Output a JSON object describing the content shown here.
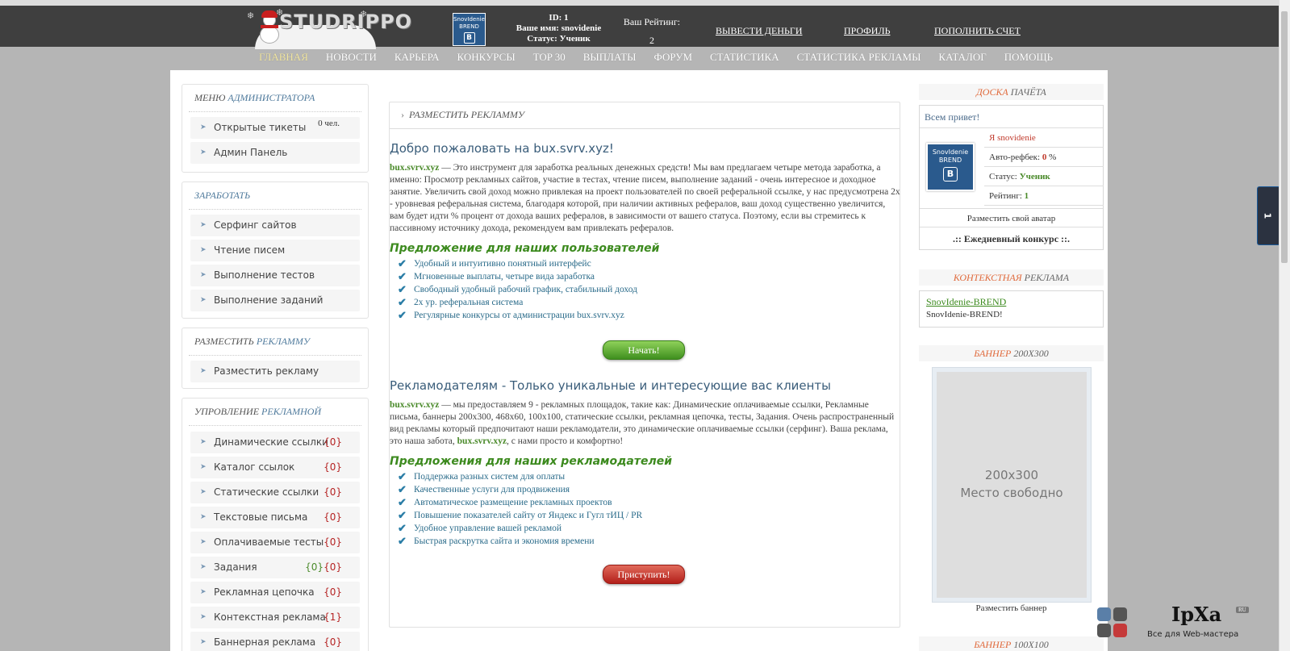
{
  "header": {
    "logo_text": "STUDRIPPO",
    "avatar_text": "SnovIdenie",
    "avatar_sub": "BREND",
    "avatar_badge": "B",
    "user_id": "ID: 1",
    "user_name_label": "Ваше имя:",
    "user_name": "snovidenie",
    "status_label": "Статус:",
    "status": "Ученик",
    "rating_label": "Ваш Рейтинг:",
    "rating_value": "2",
    "links": {
      "withdraw": "ВЫВЕСТИ ДЕНЬГИ",
      "profile": "ПРОФИЛЬ",
      "topup": "ПОПОЛНИТЬ СЧЕТ"
    }
  },
  "nav": {
    "items": [
      "ГЛАВНАЯ",
      "НОВОСТИ",
      "КАРЬЕРА",
      "КОНКУРСЫ",
      "TOP 30",
      "ВЫПЛАТЫ",
      "ФОРУМ",
      "СТАТИСТИКА",
      "СТАТИСТИКА РЕКЛАМЫ",
      "КАТАЛОГ",
      "ПОМОЩЬ"
    ],
    "active": "ГЛАВНАЯ"
  },
  "sidebar": {
    "admin": {
      "title_a": "МЕНЮ ",
      "title_b": "АДМИНИСТРАТОРА",
      "items": [
        {
          "label": "Открытые тикеты",
          "count": "0 чел."
        },
        {
          "label": "Админ Панель"
        }
      ]
    },
    "earn": {
      "title_a": "ЗАРАБОТАТЬ",
      "title_b": "",
      "items": [
        {
          "label": "Серфинг сайтов"
        },
        {
          "label": "Чтение писем"
        },
        {
          "label": "Выполнение тестов"
        },
        {
          "label": "Выполнение заданий"
        }
      ]
    },
    "place_ad": {
      "title_a": "РАЗМЕСТИТЬ ",
      "title_b": "РЕКЛАММУ",
      "items": [
        {
          "label": "Разместить рекламу"
        }
      ]
    },
    "manage_ad": {
      "title_a": "УПРОВЛЕНИЕ ",
      "title_b": "РЕКЛАМНОЙ",
      "items": [
        {
          "label": "Динамические ссылки",
          "count": "{0}"
        },
        {
          "label": "Каталог ссылок",
          "count": "{0}"
        },
        {
          "label": "Статические ссылки",
          "count": "{0}"
        },
        {
          "label": "Текстовые письма",
          "count": "{0}"
        },
        {
          "label": "Оплачиваемые тесты",
          "count": "{0}"
        },
        {
          "label": "Задания",
          "count": "{0}",
          "count2": "{0}"
        },
        {
          "label": "Рекламная цепочка",
          "count": "{0}"
        },
        {
          "label": "Контекстная реклама",
          "count": "{1}"
        },
        {
          "label": "Баннерная реклама",
          "count": "{0}"
        }
      ]
    }
  },
  "content": {
    "title": "РАЗМЕСТИТЬ РЕКЛАММУ",
    "welcome": "Добро пожаловать на bux.svrv.xyz!",
    "site": "bux.svrv.xyz",
    "intro": " — Это инструмент для заработка реальных денежных средств! Мы вам предлагаем четыре метода заработка, а именно: Просмотр рекламных сайтов, участие в тестах, чтение писем, выполнение заданий - очень интересное и доходное занятие. Увеличить свой доход можно привлекая на проект пользователей по своей реферальной ссылке, у нас предусмотрена 2x - уровневая реферальная система, благодаря которой, при наличии активных рефералов, ваш доход существенно увеличится, вам будет идти % процент от дохода ваших рефералов, в зависимости от вашего статуса. Поэтому, если вы стремитесь к пассивному источнику дохода, рекомендуем вам привлекать рефералов.",
    "offer_users_title": "Предложение для наших пользователей",
    "offer_users": [
      "Удобный и интуитивно понятный интерфейс",
      "Мгновенные выплаты, четыре вида заработка",
      "Свободный удобный рабочий график, стабильный доход",
      "2х ур. реферальная система",
      "Регулярные конкурсы от администрации bux.svrv.xyz"
    ],
    "start_button": "Начать!",
    "advertisers_title": "Рекламодателям - Только уникальные и интересующие вас клиенты",
    "advertisers_text": " — мы предоставляем 9 - рекламных площадок, такие как: Динамические оплачиваемые ссылки, Рекламные письма, баннеры 200x300, 468x60, 100x100, статические ссылки, рекламная цепочка, тесты, Задания. Очень распространенный вид рекламы который предпочитают наши рекламодатели, это динамические оплачиваемые ссылки (серфинг). Ваша реклама, это наша забота, ",
    "advertisers_tail": ", с нами просто и комфортно!",
    "offer_adv_title": "Предложения для наших рекламодателей",
    "offer_adv": [
      "Поддержка разных систем для оплаты",
      "Качественные услуги для продвижения",
      "Автоматическое размещение рекламных проектов",
      "Повышение показателей сайту от Яндекс и Гугл тИЦ / PR",
      "Удобное управление вашей рекламой",
      "Быстрая раскрутка сайта и экономия времени"
    ],
    "proceed_button": "Приступить!"
  },
  "right": {
    "board_title_a": "ДОСКА ",
    "board_title_b": "ПАЧЁТА",
    "greeting": "Всем привет!",
    "me_prefix": "Я ",
    "me_name": "snovidenie",
    "autoref_label": "Авто-рефбек: ",
    "autoref_value": "0",
    "autoref_unit": " %",
    "status_label": "Статус: ",
    "status_value": "Ученик",
    "rating_label": "Рейтинг: ",
    "rating_value": "1",
    "avatar_link": "Разместить свой аватар",
    "daily_contest": ".:: Ежедневный конкурс ::.",
    "context_title_a": "КОНТЕКСТНАЯ ",
    "context_title_b": "РЕКЛАМА",
    "context_link": "SnovIdenie-BREND",
    "context_text": "SnovIdenie-BREND!",
    "banner_title_a": "БАННЕР ",
    "banner_title_b": "200X300",
    "banner_size": "200x300",
    "banner_free": "Место свободно",
    "banner_link": "Разместить баннер",
    "banner2_title_a": "БАННЕР ",
    "banner2_title_b": "100X100"
  },
  "side_tab": "1",
  "watermark": {
    "brand": "IpXa",
    "ru": "RU",
    "tagline": "Все для Web-мастера"
  },
  "colors": {
    "header_bg": "#3f3f3f",
    "accent_green": "#3c8a1e",
    "accent_red": "#b52222",
    "link_blue": "#2a6b8a"
  }
}
